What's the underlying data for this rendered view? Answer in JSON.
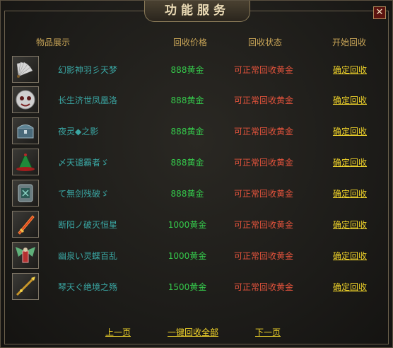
{
  "dialog": {
    "title": "功能服务",
    "close_symbol": "✕"
  },
  "headers": {
    "item": "物品展示",
    "price": "回收价格",
    "status": "回收状态",
    "action": "开始回收"
  },
  "rows": [
    {
      "name": "幻影神羽彡天梦",
      "price": "888黄金",
      "status": "可正常回收黄金",
      "action": "确定回收",
      "icon": "feather-fan-icon"
    },
    {
      "name": "长生济世凤凰洛",
      "price": "888黄金",
      "status": "可正常回收黄金",
      "action": "确定回收",
      "icon": "ghost-mask-icon"
    },
    {
      "name": "夜灵◆之影",
      "price": "888黄金",
      "status": "可正常回收黄金",
      "action": "确定回收",
      "icon": "chest-icon"
    },
    {
      "name": "〆天谴霸者ゞ",
      "price": "888黄金",
      "status": "可正常回收黄金",
      "action": "确定回收",
      "icon": "green-hat-icon"
    },
    {
      "name": "て無剑残破ゞ",
      "price": "888黄金",
      "status": "可正常回收黄金",
      "action": "确定回收",
      "icon": "stone-tablet-icon"
    },
    {
      "name": "断阳ノ破灭恒星",
      "price": "1000黄金",
      "status": "可正常回收黄金",
      "action": "确定回收",
      "icon": "flame-sword-icon"
    },
    {
      "name": "幽泉い灵蝶百乱",
      "price": "1000黄金",
      "status": "可正常回收黄金",
      "action": "确定回收",
      "icon": "winged-armor-icon"
    },
    {
      "name": "琴天ぐ绝境之殇",
      "price": "1500黄金",
      "status": "可正常回收黄金",
      "action": "确定回收",
      "icon": "golden-spear-icon"
    }
  ],
  "footer": {
    "prev": "上一页",
    "recycle_all": "一键回收全部",
    "next": "下一页"
  }
}
